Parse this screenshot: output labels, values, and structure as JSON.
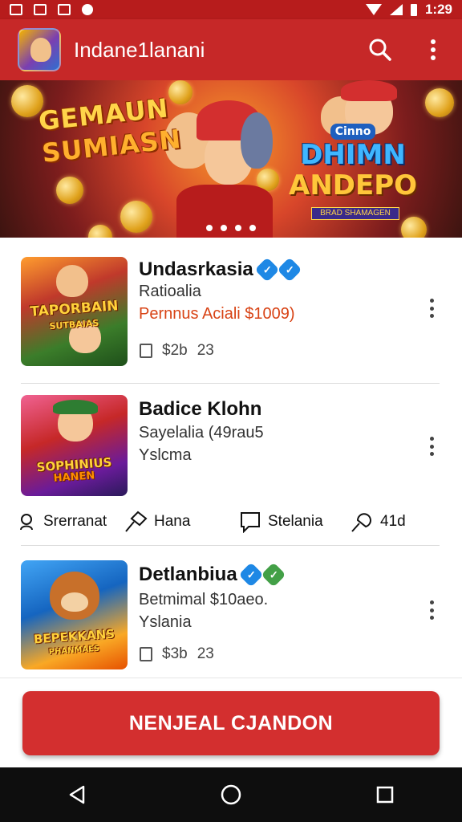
{
  "status_bar": {
    "time": "1:29",
    "left_icons": [
      "image-notification-icon",
      "image-notification-icon",
      "image-notification-icon",
      "circle-notification-icon"
    ],
    "right_icons": [
      "wifi-icon",
      "signal-icon",
      "battery-icon"
    ]
  },
  "app_bar": {
    "title": "Indane1lanani",
    "icons": [
      "app-logo",
      "search-icon",
      "more-vertical-icon"
    ]
  },
  "banner": {
    "text_left_line1": "GEMAUN",
    "text_left_line2": "SUMIASN",
    "text_right_small": "Cinno",
    "text_right_line1": "DHIMN",
    "text_right_line2": "ANDEPO",
    "text_right_sub": "BRAD SHAMAGEN",
    "dots_count": 4
  },
  "items": [
    {
      "title": "Undasrkasia",
      "subtitle": "Ratioalia",
      "price_line": "Pernnus Aciali $1009)",
      "meta_value": "$2b",
      "meta_count": "23",
      "thumb_label": "TAPORBAIN",
      "thumb_sub": "SUTBAIAS",
      "badge_colors": [
        "#1e88e5",
        "#1e88e5"
      ]
    },
    {
      "title": "Badice Klohn",
      "subtitle": "Sayelalia (49rau5",
      "line3": "Yslcma",
      "thumb_label": "SOPHINIUS",
      "thumb_sub": "HANEN"
    },
    {
      "title": "Detlanbiua",
      "subtitle": "Betmimal $10aeo.",
      "line3": "Yslania",
      "meta_value": "$3b",
      "meta_count": "23",
      "thumb_label": "BEPEKKANS",
      "thumb_sub": "PHANMAES",
      "badge_colors": [
        "#1e88e5",
        "#43a047"
      ]
    }
  ],
  "actions": [
    {
      "label": "Srerranat",
      "icon": "person-icon"
    },
    {
      "label": "Hana",
      "icon": "tag-icon"
    },
    {
      "label": "Stelania",
      "icon": "chat-icon"
    },
    {
      "label": "41d",
      "icon": "share-icon"
    }
  ],
  "cta": {
    "label": "NENJEAL CJANDON"
  },
  "nav": [
    "back-icon",
    "home-icon",
    "recents-icon"
  ],
  "colors": {
    "primary": "#c62828",
    "cta": "#d32f2f",
    "status": "#b71c1c"
  }
}
